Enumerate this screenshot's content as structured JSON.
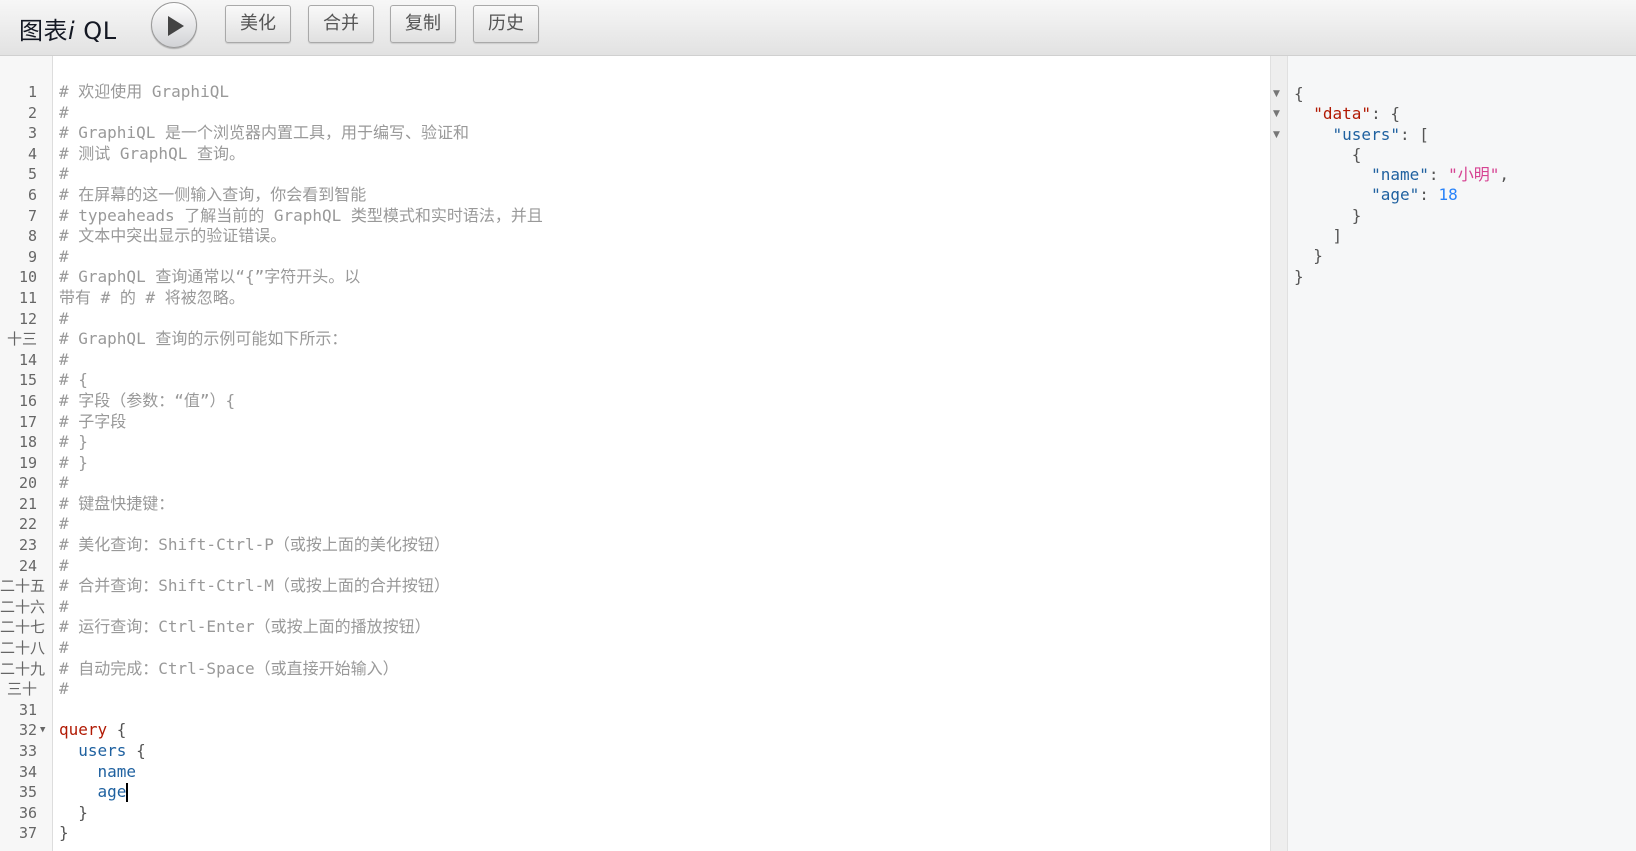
{
  "app": {
    "title_main": "图表",
    "title_i": "i",
    "title_tail": " QL"
  },
  "toolbar": {
    "run_icon": "play-icon",
    "prettify_label": "美化",
    "merge_label": "合并",
    "copy_label": "复制",
    "history_label": "历史"
  },
  "editor": {
    "lines": [
      {
        "n": "1",
        "parts": [
          {
            "t": "# 欢迎使用 GraphiQL",
            "c": "cm"
          }
        ]
      },
      {
        "n": "2",
        "parts": [
          {
            "t": "#",
            "c": "cm"
          }
        ]
      },
      {
        "n": "3",
        "parts": [
          {
            "t": "# GraphiQL 是一个浏览器内置工具，用于编写、验证和",
            "c": "cm"
          }
        ]
      },
      {
        "n": "4",
        "parts": [
          {
            "t": "# 测试 GraphQL 查询。",
            "c": "cm"
          }
        ]
      },
      {
        "n": "5",
        "parts": [
          {
            "t": "#",
            "c": "cm"
          }
        ]
      },
      {
        "n": "6",
        "parts": [
          {
            "t": "# 在屏幕的这一侧输入查询，你会看到智能",
            "c": "cm"
          }
        ]
      },
      {
        "n": "7",
        "parts": [
          {
            "t": "# typeaheads 了解当前的 GraphQL 类型模式和实时语法，并且",
            "c": "cm"
          }
        ]
      },
      {
        "n": "8",
        "parts": [
          {
            "t": "# 文本中突出显示的验证错误。",
            "c": "cm"
          }
        ]
      },
      {
        "n": "9",
        "parts": [
          {
            "t": "#",
            "c": "cm"
          }
        ]
      },
      {
        "n": "10",
        "parts": [
          {
            "t": "# GraphQL 查询通常以“{”字符开头。以",
            "c": "cm"
          }
        ]
      },
      {
        "n": "11",
        "parts": [
          {
            "t": "带有 # 的 # 将被忽略。",
            "c": "cm"
          }
        ]
      },
      {
        "n": "12",
        "parts": [
          {
            "t": "#",
            "c": "cm"
          }
        ]
      },
      {
        "n": "十三",
        "parts": [
          {
            "t": "# GraphQL 查询的示例可能如下所示：",
            "c": "cm"
          }
        ]
      },
      {
        "n": "14",
        "parts": [
          {
            "t": "#",
            "c": "cm"
          }
        ]
      },
      {
        "n": "15",
        "parts": [
          {
            "t": "# {",
            "c": "cm"
          }
        ]
      },
      {
        "n": "16",
        "parts": [
          {
            "t": "# 字段（参数：“值”）{",
            "c": "cm"
          }
        ]
      },
      {
        "n": "17",
        "parts": [
          {
            "t": "# 子字段",
            "c": "cm"
          }
        ]
      },
      {
        "n": "18",
        "parts": [
          {
            "t": "# }",
            "c": "cm"
          }
        ]
      },
      {
        "n": "19",
        "parts": [
          {
            "t": "# }",
            "c": "cm"
          }
        ]
      },
      {
        "n": "20",
        "parts": [
          {
            "t": "#",
            "c": "cm"
          }
        ]
      },
      {
        "n": "21",
        "parts": [
          {
            "t": "# 键盘快捷键：",
            "c": "cm"
          }
        ]
      },
      {
        "n": "22",
        "parts": [
          {
            "t": "#",
            "c": "cm"
          }
        ]
      },
      {
        "n": "23",
        "parts": [
          {
            "t": "# 美化查询：Shift-Ctrl-P（或按上面的美化按钮）",
            "c": "cm"
          }
        ]
      },
      {
        "n": "24",
        "parts": [
          {
            "t": "#",
            "c": "cm"
          }
        ]
      },
      {
        "n": "二十五",
        "parts": [
          {
            "t": "# 合并查询：Shift-Ctrl-M（或按上面的合并按钮）",
            "c": "cm"
          }
        ]
      },
      {
        "n": "二十六",
        "parts": [
          {
            "t": "#",
            "c": "cm"
          }
        ]
      },
      {
        "n": "二十七",
        "parts": [
          {
            "t": "# 运行查询：Ctrl-Enter（或按上面的播放按钮）",
            "c": "cm"
          }
        ]
      },
      {
        "n": "二十八",
        "parts": [
          {
            "t": "#",
            "c": "cm"
          }
        ]
      },
      {
        "n": "二十九",
        "parts": [
          {
            "t": "# 自动完成：Ctrl-Space（或直接开始输入）",
            "c": "cm"
          }
        ]
      },
      {
        "n": "三十",
        "parts": [
          {
            "t": "#",
            "c": "cm"
          }
        ]
      },
      {
        "n": "31",
        "parts": []
      },
      {
        "n": "32",
        "fold": true,
        "parts": [
          {
            "t": "query",
            "c": "kw"
          },
          {
            "t": " {",
            "c": "pu"
          }
        ]
      },
      {
        "n": "33",
        "parts": [
          {
            "t": "  users",
            "c": "fld"
          },
          {
            "t": " {",
            "c": "pu"
          }
        ]
      },
      {
        "n": "34",
        "parts": [
          {
            "t": "    name",
            "c": "fld"
          }
        ]
      },
      {
        "n": "35",
        "cursor": true,
        "parts": [
          {
            "t": "    age",
            "c": "fld"
          }
        ]
      },
      {
        "n": "36",
        "parts": [
          {
            "t": "  }",
            "c": "pu"
          }
        ]
      },
      {
        "n": "37",
        "parts": [
          {
            "t": "}",
            "c": "pu"
          }
        ]
      }
    ]
  },
  "result": {
    "lines": [
      {
        "fold": true,
        "parts": [
          {
            "t": "{",
            "c": "pu"
          }
        ]
      },
      {
        "fold": true,
        "parts": [
          {
            "t": "  ",
            "c": "pu"
          },
          {
            "t": "\"data\"",
            "c": "keyd"
          },
          {
            "t": ": {",
            "c": "pu"
          }
        ]
      },
      {
        "fold": true,
        "parts": [
          {
            "t": "    ",
            "c": "pu"
          },
          {
            "t": "\"users\"",
            "c": "key"
          },
          {
            "t": ": [",
            "c": "pu"
          }
        ]
      },
      {
        "parts": [
          {
            "t": "      {",
            "c": "pu"
          }
        ]
      },
      {
        "parts": [
          {
            "t": "        ",
            "c": "pu"
          },
          {
            "t": "\"name\"",
            "c": "key"
          },
          {
            "t": ": ",
            "c": "pu"
          },
          {
            "t": "\"小明\"",
            "c": "str"
          },
          {
            "t": ",",
            "c": "pu"
          }
        ]
      },
      {
        "parts": [
          {
            "t": "        ",
            "c": "pu"
          },
          {
            "t": "\"age\"",
            "c": "key"
          },
          {
            "t": ": ",
            "c": "pu"
          },
          {
            "t": "18",
            "c": "num"
          }
        ]
      },
      {
        "parts": [
          {
            "t": "      }",
            "c": "pu"
          }
        ]
      },
      {
        "parts": [
          {
            "t": "    ]",
            "c": "pu"
          }
        ]
      },
      {
        "parts": [
          {
            "t": "  }",
            "c": "pu"
          }
        ]
      },
      {
        "parts": [
          {
            "t": "}",
            "c": "pu"
          }
        ]
      }
    ]
  }
}
